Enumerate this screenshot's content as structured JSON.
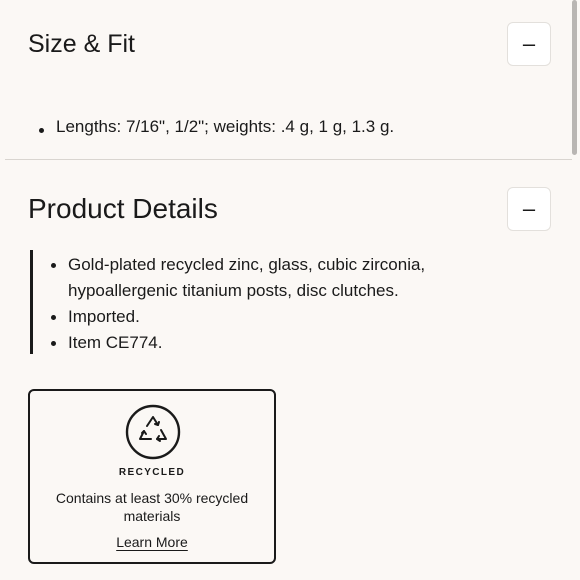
{
  "size_fit": {
    "title": "Size & Fit",
    "toggle_symbol": "–",
    "items": [
      "Lengths: 7/16\", 1/2\"; weights: .4 g, 1 g, 1.3 g."
    ]
  },
  "product_details": {
    "title": "Product Details",
    "toggle_symbol": "–",
    "items": [
      "Gold-plated recycled zinc, glass, cubic zirconia,",
      "hypoallergenic titanium posts, disc clutches.",
      "Imported.",
      "Item CE774."
    ]
  },
  "recycled_card": {
    "icon": "recycle-icon",
    "label": "RECYCLED",
    "description": "Contains at least 30% recycled materials",
    "link": "Learn More"
  }
}
